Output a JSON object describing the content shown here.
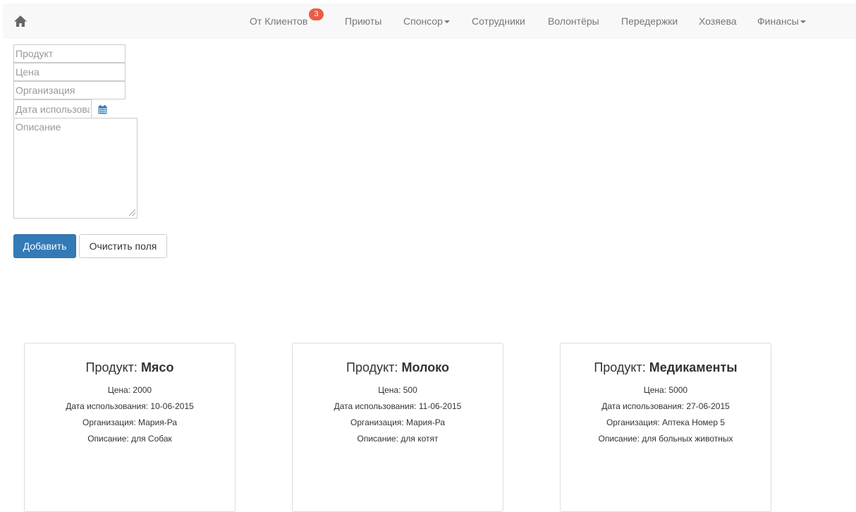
{
  "nav": {
    "items": [
      {
        "label": "От Клиентов",
        "badge": "3"
      },
      {
        "label": "Приюты"
      },
      {
        "label": "Спонсор",
        "dropdown": true
      },
      {
        "label": "Сотрудники"
      },
      {
        "label": "Волонтёры"
      },
      {
        "label": "Передержки"
      },
      {
        "label": "Хозяева"
      },
      {
        "label": "Финансы",
        "dropdown": true
      }
    ],
    "home_icon": "home-icon"
  },
  "form": {
    "product_placeholder": "Продукт",
    "price_placeholder": "Цена",
    "organization_placeholder": "Организация",
    "date_placeholder": "Дата использования",
    "description_placeholder": "Описание",
    "add_label": "Добавить",
    "clear_label": "Очистить поля"
  },
  "labels": {
    "product": "Продукт:",
    "price": "Цена:",
    "date": "Дата использования:",
    "organization": "Организация:",
    "description": "Описание:"
  },
  "cards": [
    {
      "product": "Мясо",
      "price": "2000",
      "date": "10-06-2015",
      "organization": "Мария-Ра",
      "description": "для Собак"
    },
    {
      "product": "Молоко",
      "price": "500",
      "date": "11-06-2015",
      "organization": "Мария-Ра",
      "description": "для котят"
    },
    {
      "product": "Медикаменты",
      "price": "5000",
      "date": "27-06-2015",
      "organization": "Аптека Номер 5",
      "description": "для больных животных"
    }
  ],
  "colors": {
    "primary": "#337ab7",
    "badge": "#ec5c46",
    "navbar_bg": "#f8f8f8",
    "nav_text": "#777777"
  }
}
